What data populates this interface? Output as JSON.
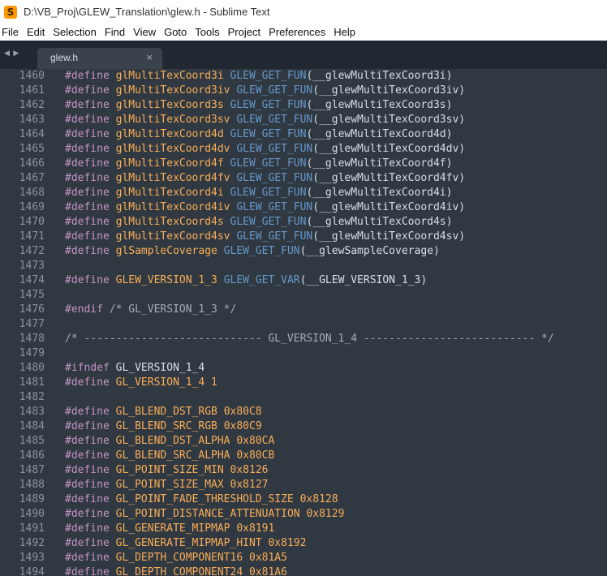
{
  "window": {
    "title": "D:\\VB_Proj\\GLEW_Translation\\glew.h - Sublime Text"
  },
  "menu": [
    "File",
    "Edit",
    "Selection",
    "Find",
    "View",
    "Goto",
    "Tools",
    "Project",
    "Preferences",
    "Help"
  ],
  "tabs": [
    {
      "label": "glew.h",
      "close": "×",
      "active": true
    }
  ],
  "nav_arrows": "◀ ▶",
  "colors": {
    "background": "#303841",
    "keyword": "#c695c6",
    "function": "#f9ae58",
    "macro": "#6699cc",
    "text": "#d8dee9",
    "comment": "#a6acb9",
    "gutter": "#8a95a1"
  },
  "editor": {
    "lines": [
      {
        "n": "1460",
        "t": [
          [
            "kw",
            "#define "
          ],
          [
            "fn",
            "glMultiTexCoord3i "
          ],
          [
            "mac",
            "GLEW_GET_FUN"
          ],
          [
            "txt",
            "(__glewMultiTexCoord3i)"
          ]
        ]
      },
      {
        "n": "1461",
        "t": [
          [
            "kw",
            "#define "
          ],
          [
            "fn",
            "glMultiTexCoord3iv "
          ],
          [
            "mac",
            "GLEW_GET_FUN"
          ],
          [
            "txt",
            "(__glewMultiTexCoord3iv)"
          ]
        ]
      },
      {
        "n": "1462",
        "t": [
          [
            "kw",
            "#define "
          ],
          [
            "fn",
            "glMultiTexCoord3s "
          ],
          [
            "mac",
            "GLEW_GET_FUN"
          ],
          [
            "txt",
            "(__glewMultiTexCoord3s)"
          ]
        ]
      },
      {
        "n": "1463",
        "t": [
          [
            "kw",
            "#define "
          ],
          [
            "fn",
            "glMultiTexCoord3sv "
          ],
          [
            "mac",
            "GLEW_GET_FUN"
          ],
          [
            "txt",
            "(__glewMultiTexCoord3sv)"
          ]
        ]
      },
      {
        "n": "1464",
        "t": [
          [
            "kw",
            "#define "
          ],
          [
            "fn",
            "glMultiTexCoord4d "
          ],
          [
            "mac",
            "GLEW_GET_FUN"
          ],
          [
            "txt",
            "(__glewMultiTexCoord4d)"
          ]
        ]
      },
      {
        "n": "1465",
        "t": [
          [
            "kw",
            "#define "
          ],
          [
            "fn",
            "glMultiTexCoord4dv "
          ],
          [
            "mac",
            "GLEW_GET_FUN"
          ],
          [
            "txt",
            "(__glewMultiTexCoord4dv)"
          ]
        ]
      },
      {
        "n": "1466",
        "t": [
          [
            "kw",
            "#define "
          ],
          [
            "fn",
            "glMultiTexCoord4f "
          ],
          [
            "mac",
            "GLEW_GET_FUN"
          ],
          [
            "txt",
            "(__glewMultiTexCoord4f)"
          ]
        ]
      },
      {
        "n": "1467",
        "t": [
          [
            "kw",
            "#define "
          ],
          [
            "fn",
            "glMultiTexCoord4fv "
          ],
          [
            "mac",
            "GLEW_GET_FUN"
          ],
          [
            "txt",
            "(__glewMultiTexCoord4fv)"
          ]
        ]
      },
      {
        "n": "1468",
        "t": [
          [
            "kw",
            "#define "
          ],
          [
            "fn",
            "glMultiTexCoord4i "
          ],
          [
            "mac",
            "GLEW_GET_FUN"
          ],
          [
            "txt",
            "(__glewMultiTexCoord4i)"
          ]
        ]
      },
      {
        "n": "1469",
        "t": [
          [
            "kw",
            "#define "
          ],
          [
            "fn",
            "glMultiTexCoord4iv "
          ],
          [
            "mac",
            "GLEW_GET_FUN"
          ],
          [
            "txt",
            "(__glewMultiTexCoord4iv)"
          ]
        ]
      },
      {
        "n": "1470",
        "t": [
          [
            "kw",
            "#define "
          ],
          [
            "fn",
            "glMultiTexCoord4s "
          ],
          [
            "mac",
            "GLEW_GET_FUN"
          ],
          [
            "txt",
            "(__glewMultiTexCoord4s)"
          ]
        ]
      },
      {
        "n": "1471",
        "t": [
          [
            "kw",
            "#define "
          ],
          [
            "fn",
            "glMultiTexCoord4sv "
          ],
          [
            "mac",
            "GLEW_GET_FUN"
          ],
          [
            "txt",
            "(__glewMultiTexCoord4sv)"
          ]
        ]
      },
      {
        "n": "1472",
        "t": [
          [
            "kw",
            "#define "
          ],
          [
            "fn",
            "glSampleCoverage "
          ],
          [
            "mac",
            "GLEW_GET_FUN"
          ],
          [
            "txt",
            "(__glewSampleCoverage)"
          ]
        ]
      },
      {
        "n": "1473",
        "t": []
      },
      {
        "n": "1474",
        "t": [
          [
            "kw",
            "#define "
          ],
          [
            "fn",
            "GLEW_VERSION_1_3 "
          ],
          [
            "mac",
            "GLEW_GET_VAR"
          ],
          [
            "txt",
            "(__GLEW_VERSION_1_3)"
          ]
        ]
      },
      {
        "n": "1475",
        "t": []
      },
      {
        "n": "1476",
        "t": [
          [
            "kw",
            "#endif "
          ],
          [
            "cmt",
            "/* GL_VERSION_1_3 */"
          ]
        ]
      },
      {
        "n": "1477",
        "t": []
      },
      {
        "n": "1478",
        "t": [
          [
            "cmt",
            "/* ---------------------------- GL_VERSION_1_4 --------------------------- */"
          ]
        ]
      },
      {
        "n": "1479",
        "t": []
      },
      {
        "n": "1480",
        "t": [
          [
            "kw",
            "#ifndef "
          ],
          [
            "txt",
            "GL_VERSION_1_4"
          ]
        ]
      },
      {
        "n": "1481",
        "t": [
          [
            "kw",
            "#define "
          ],
          [
            "fn",
            "GL_VERSION_1_4 "
          ],
          [
            "num",
            "1"
          ]
        ]
      },
      {
        "n": "1482",
        "t": []
      },
      {
        "n": "1483",
        "t": [
          [
            "kw",
            "#define "
          ],
          [
            "fn",
            "GL_BLEND_DST_RGB "
          ],
          [
            "num",
            "0x80C8"
          ]
        ]
      },
      {
        "n": "1484",
        "t": [
          [
            "kw",
            "#define "
          ],
          [
            "fn",
            "GL_BLEND_SRC_RGB "
          ],
          [
            "num",
            "0x80C9"
          ]
        ]
      },
      {
        "n": "1485",
        "t": [
          [
            "kw",
            "#define "
          ],
          [
            "fn",
            "GL_BLEND_DST_ALPHA "
          ],
          [
            "num",
            "0x80CA"
          ]
        ]
      },
      {
        "n": "1486",
        "t": [
          [
            "kw",
            "#define "
          ],
          [
            "fn",
            "GL_BLEND_SRC_ALPHA "
          ],
          [
            "num",
            "0x80CB"
          ]
        ]
      },
      {
        "n": "1487",
        "t": [
          [
            "kw",
            "#define "
          ],
          [
            "fn",
            "GL_POINT_SIZE_MIN "
          ],
          [
            "num",
            "0x8126"
          ]
        ]
      },
      {
        "n": "1488",
        "t": [
          [
            "kw",
            "#define "
          ],
          [
            "fn",
            "GL_POINT_SIZE_MAX "
          ],
          [
            "num",
            "0x8127"
          ]
        ]
      },
      {
        "n": "1489",
        "t": [
          [
            "kw",
            "#define "
          ],
          [
            "fn",
            "GL_POINT_FADE_THRESHOLD_SIZE "
          ],
          [
            "num",
            "0x8128"
          ]
        ]
      },
      {
        "n": "1490",
        "t": [
          [
            "kw",
            "#define "
          ],
          [
            "fn",
            "GL_POINT_DISTANCE_ATTENUATION "
          ],
          [
            "num",
            "0x8129"
          ]
        ]
      },
      {
        "n": "1491",
        "t": [
          [
            "kw",
            "#define "
          ],
          [
            "fn",
            "GL_GENERATE_MIPMAP "
          ],
          [
            "num",
            "0x8191"
          ]
        ]
      },
      {
        "n": "1492",
        "t": [
          [
            "kw",
            "#define "
          ],
          [
            "fn",
            "GL_GENERATE_MIPMAP_HINT "
          ],
          [
            "num",
            "0x8192"
          ]
        ]
      },
      {
        "n": "1493",
        "t": [
          [
            "kw",
            "#define "
          ],
          [
            "fn",
            "GL_DEPTH_COMPONENT16 "
          ],
          [
            "num",
            "0x81A5"
          ]
        ]
      },
      {
        "n": "1494",
        "t": [
          [
            "kw",
            "#define "
          ],
          [
            "fn",
            "GL_DEPTH_COMPONENT24 "
          ],
          [
            "num",
            "0x81A6"
          ]
        ]
      }
    ]
  }
}
